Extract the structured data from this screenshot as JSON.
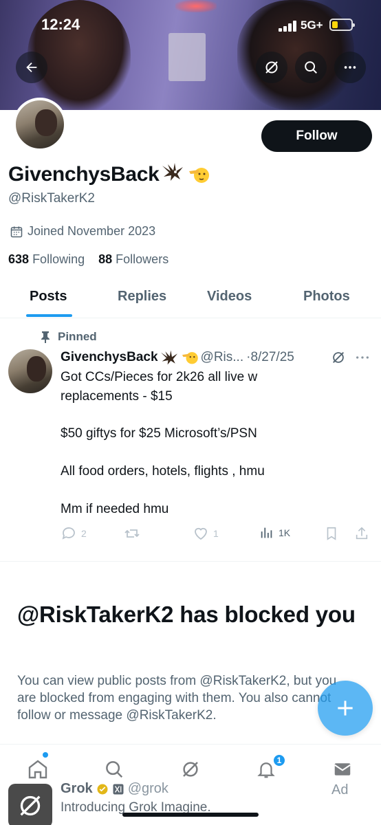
{
  "status_bar": {
    "time": "12:24",
    "network": "5G+"
  },
  "banner": {
    "alt": "profile banner"
  },
  "profile": {
    "display_name": "GivenchysBack",
    "handle": "@RiskTakerK2",
    "joined": "Joined November 2023",
    "following_count": "638",
    "following_label": "Following",
    "followers_count": "88",
    "followers_label": "Followers",
    "follow_button": "Follow"
  },
  "tabs": [
    {
      "label": "Posts",
      "active": true
    },
    {
      "label": "Replies",
      "active": false
    },
    {
      "label": "Videos",
      "active": false
    },
    {
      "label": "Photos",
      "active": false
    }
  ],
  "pinned_post": {
    "pinned_label": "Pinned",
    "author_name": "GivenchysBack",
    "author_handle_truncated": "@Ris...",
    "date": "8/27/25",
    "lines": [
      "Got CCs/Pieces for 2k26 all live w",
      "replacements - $15",
      "$50 giftys for $25 Microsoft’s/PSN",
      "All food orders, hotels, flights , hmu",
      "Mm if needed hmu"
    ],
    "reply_count": "2",
    "like_count": "1",
    "view_count": "1K"
  },
  "blocked": {
    "title": "@RiskTakerK2 has blocked you",
    "message": "You can view public posts from @RiskTakerK2, but you are blocked from engaging with them. You also cannot follow or message @RiskTakerK2."
  },
  "bottom_nav": {
    "notification_count": "1"
  },
  "ad": {
    "name": "Grok",
    "handle": "@grok",
    "description": "Introducing Grok Imagine.",
    "label": "Ad"
  }
}
